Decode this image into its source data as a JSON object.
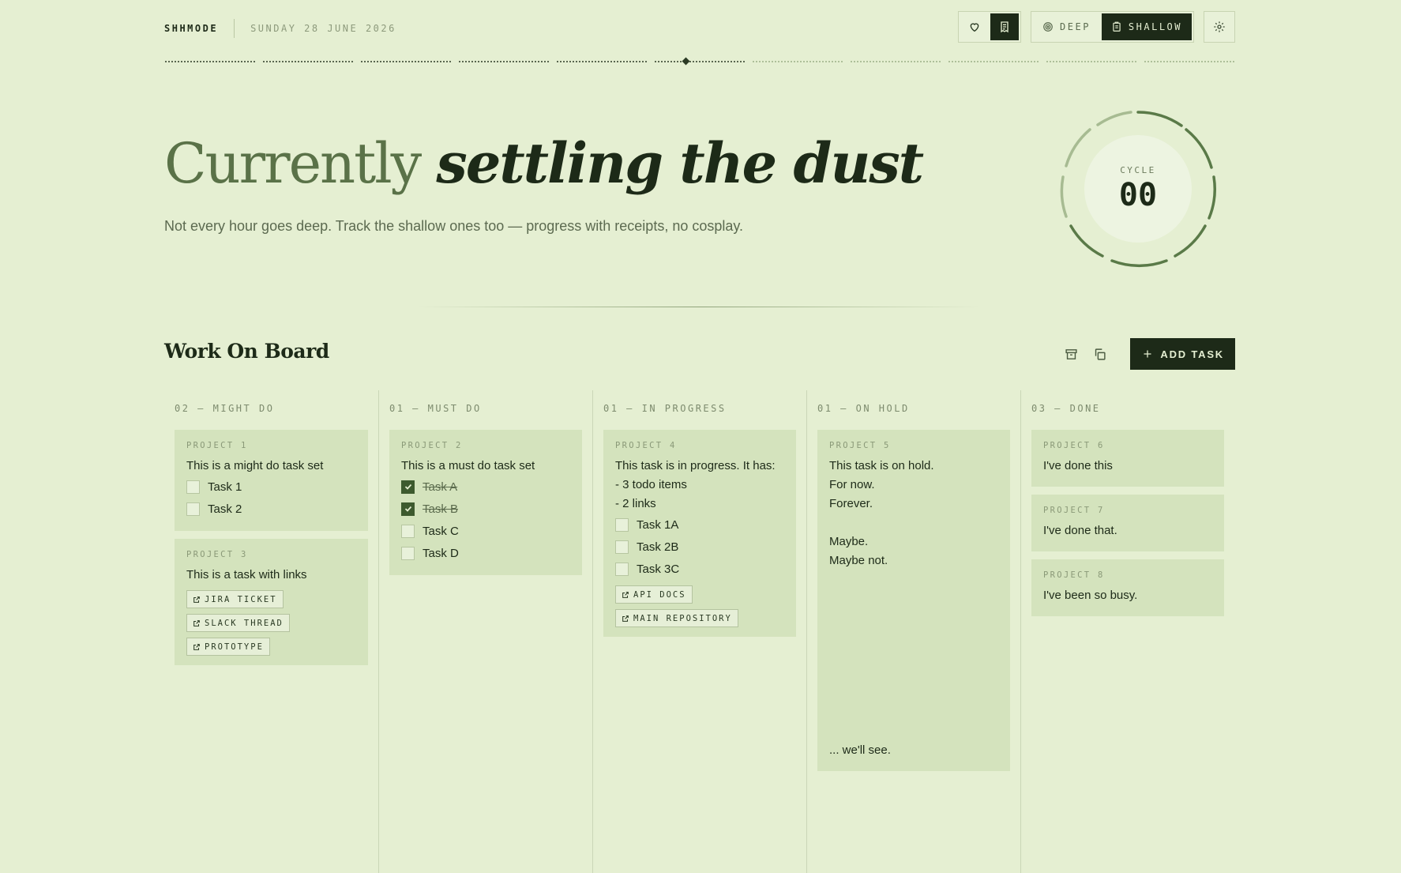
{
  "header": {
    "brand": "SHHMODE",
    "date": "SUNDAY 28 JUNE 2026",
    "modes": {
      "deep": "DEEP",
      "shallow": "SHALLOW",
      "active": "shallow"
    }
  },
  "hero": {
    "title_plain": "Currently",
    "title_italic": "settling the dust",
    "subtitle": "Not every hour goes deep. Track the shallow ones too — progress with receipts, no cosplay."
  },
  "cycle": {
    "label": "CYCLE",
    "value": "00"
  },
  "board": {
    "title": "Work On Board",
    "add_label": "ADD TASK",
    "columns": [
      {
        "title": "02 — MIGHT DO",
        "cards": [
          {
            "project": "PROJECT 1",
            "text": "This is a might do task set",
            "tasks": [
              {
                "label": "Task 1",
                "done": false
              },
              {
                "label": "Task 2",
                "done": false
              }
            ]
          },
          {
            "project": "PROJECT 3",
            "text": "This is a task with links",
            "links": [
              "JIRA TICKET",
              "SLACK THREAD",
              "PROTOTYPE"
            ]
          }
        ]
      },
      {
        "title": "01 — MUST DO",
        "cards": [
          {
            "project": "PROJECT 2",
            "text": "This is a must do task set",
            "tasks": [
              {
                "label": "Task A",
                "done": true
              },
              {
                "label": "Task B",
                "done": true
              },
              {
                "label": "Task C",
                "done": false
              },
              {
                "label": "Task D",
                "done": false
              }
            ]
          }
        ]
      },
      {
        "title": "01 — IN PROGRESS",
        "cards": [
          {
            "project": "PROJECT 4",
            "text": "This task is in progress. It has:\n- 3 todo items\n- 2 links",
            "tasks": [
              {
                "label": "Task 1A",
                "done": false
              },
              {
                "label": "Task 2B",
                "done": false
              },
              {
                "label": "Task 3C",
                "done": false
              }
            ],
            "links": [
              "API DOCS",
              "MAIN REPOSITORY"
            ]
          }
        ]
      },
      {
        "title": "01 — ON HOLD",
        "cards": [
          {
            "project": "PROJECT 5",
            "text": "This task is on hold.\nFor now.\nForever.\n\nMaybe.\nMaybe not.\n\n\n\n\n\n\n\n\n\n... we'll see."
          }
        ]
      },
      {
        "title": "03 — DONE",
        "cards": [
          {
            "project": "PROJECT 6",
            "text": "I've done this"
          },
          {
            "project": "PROJECT 7",
            "text": "I've done that."
          },
          {
            "project": "PROJECT 8",
            "text": "I've been so busy."
          }
        ]
      }
    ]
  },
  "colors": {
    "background": "#e5efd2",
    "card": "#d4e3bd",
    "dark": "#1d2a18",
    "accent": "#5a7248"
  }
}
